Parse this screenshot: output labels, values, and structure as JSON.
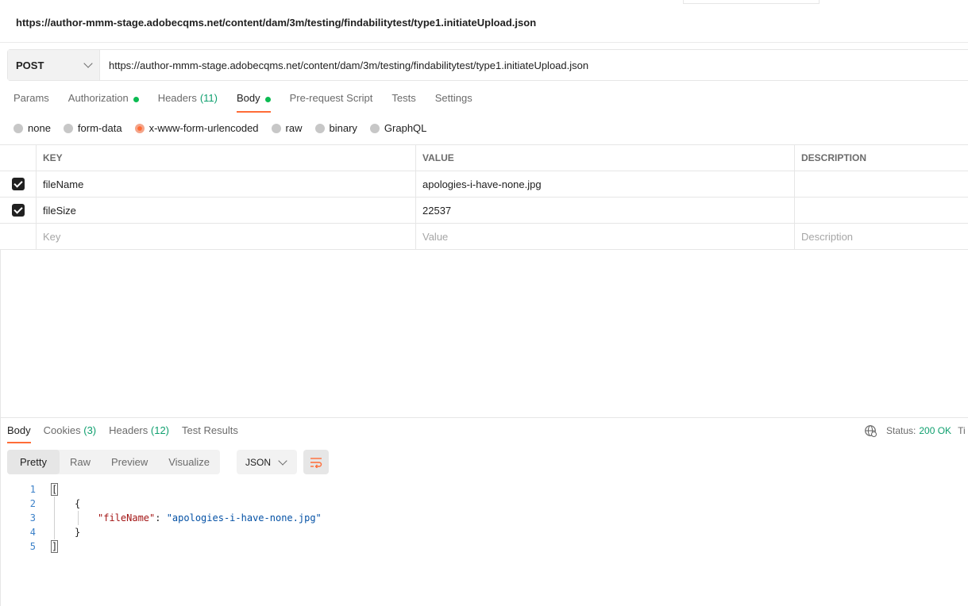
{
  "request": {
    "title": "https://author-mmm-stage.adobecqms.net/content/dam/3m/testing/findabilitytest/type1.initiateUpload.json",
    "method": "POST",
    "url": "https://author-mmm-stage.adobecqms.net/content/dam/3m/testing/findabilitytest/type1.initiateUpload.json"
  },
  "request_tabs": [
    {
      "label": "Params",
      "count": ""
    },
    {
      "label": "Authorization",
      "count": "",
      "dot": true
    },
    {
      "label": "Headers",
      "count": "(11)"
    },
    {
      "label": "Body",
      "count": "",
      "dot": true,
      "active": true
    },
    {
      "label": "Pre-request Script",
      "count": ""
    },
    {
      "label": "Tests",
      "count": ""
    },
    {
      "label": "Settings",
      "count": ""
    }
  ],
  "body_modes": [
    {
      "label": "none",
      "checked": false
    },
    {
      "label": "form-data",
      "checked": false
    },
    {
      "label": "x-www-form-urlencoded",
      "checked": true
    },
    {
      "label": "raw",
      "checked": false
    },
    {
      "label": "binary",
      "checked": false
    },
    {
      "label": "GraphQL",
      "checked": false
    }
  ],
  "params_table": {
    "headers": {
      "key": "KEY",
      "value": "VALUE",
      "description": "DESCRIPTION"
    },
    "rows": [
      {
        "key": "fileName",
        "value": "apologies-i-have-none.jpg",
        "description": ""
      },
      {
        "key": "fileSize",
        "value": "22537",
        "description": ""
      }
    ],
    "placeholders": {
      "key": "Key",
      "value": "Value",
      "description": "Description"
    }
  },
  "response_tabs": [
    {
      "label": "Body",
      "count": ""
    },
    {
      "label": "Cookies",
      "count": "(3)"
    },
    {
      "label": "Headers",
      "count": "(12)"
    },
    {
      "label": "Test Results",
      "count": ""
    }
  ],
  "status": {
    "label": "Status:",
    "value": "200 OK",
    "truncated": "Ti"
  },
  "view_modes": [
    "Pretty",
    "Raw",
    "Preview",
    "Visualize"
  ],
  "format": "JSON",
  "code": {
    "line_numbers": [
      "1",
      "2",
      "3",
      "4",
      "5"
    ],
    "open_bracket": "[",
    "open_brace": "{",
    "key": "\"fileName\"",
    "colon": ": ",
    "value": "\"apologies-i-have-none.jpg\"",
    "close_brace": "}",
    "close_bracket": "]"
  },
  "colors": {
    "accent": "#ff6c37",
    "success": "#0e9f6e",
    "dot": "#0cbb52",
    "json_key": "#a31515",
    "json_string": "#0451a5",
    "line_number": "#3b80c8"
  }
}
